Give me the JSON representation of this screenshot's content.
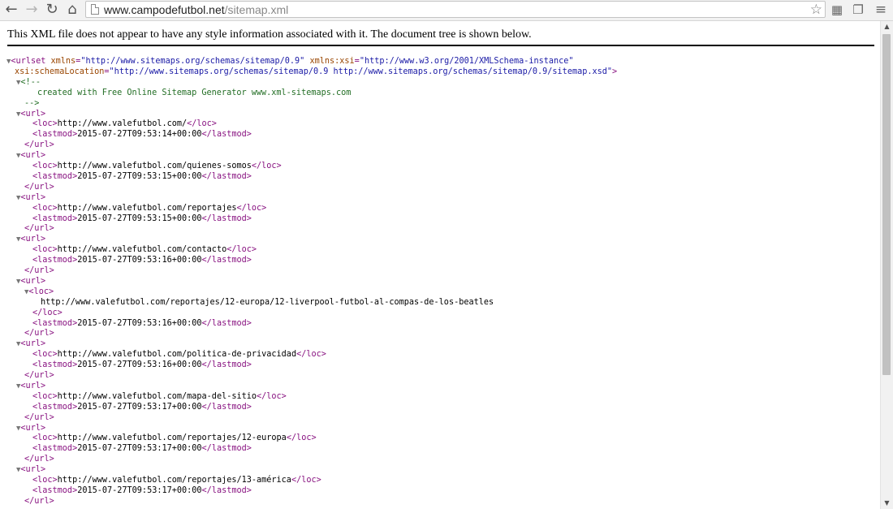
{
  "browser": {
    "url_domain": "www.campodefutbol.net",
    "url_path": "/sitemap.xml"
  },
  "icons": {
    "back": "arrow-left-icon",
    "forward": "arrow-right-icon",
    "reload": "reload-icon",
    "home": "home-icon",
    "page": "page-icon",
    "bookmark": "star-icon",
    "ext1": "extension-grid-icon",
    "ext2": "extension-pages-icon",
    "menu": "hamburger-menu-icon"
  },
  "notice": "This XML file does not appear to have any style information associated with it. The document tree is shown below.",
  "xml": {
    "root_open_1": "<urlset xmlns=\"http://www.sitemaps.org/schemas/sitemap/0.9\" xmlns:xsi=\"http://www.w3.org/2001/XMLSchema-instance\"",
    "root_open_2": "xsi:schemaLocation=\"http://www.sitemaps.org/schemas/sitemap/0.9 http://www.sitemaps.org/schemas/sitemap/0.9/sitemap.xsd\">",
    "comment_open": "<!--",
    "comment_text": "created with Free Online Sitemap Generator www.xml-sitemaps.com",
    "comment_close": "-->",
    "urls": [
      {
        "loc": "http://www.valefutbol.com/",
        "lastmod": "2015-07-27T09:53:14+00:00"
      },
      {
        "loc": "http://www.valefutbol.com/quienes-somos",
        "lastmod": "2015-07-27T09:53:15+00:00"
      },
      {
        "loc": "http://www.valefutbol.com/reportajes",
        "lastmod": "2015-07-27T09:53:15+00:00"
      },
      {
        "loc": "http://www.valefutbol.com/contacto",
        "lastmod": "2015-07-27T09:53:16+00:00"
      },
      {
        "loc": "http://www.valefutbol.com/reportajes/12-europa/12-liverpool-futbol-al-compas-de-los-beatles",
        "lastmod": "2015-07-27T09:53:16+00:00",
        "expanded": true
      },
      {
        "loc": "http://www.valefutbol.com/politica-de-privacidad",
        "lastmod": "2015-07-27T09:53:16+00:00"
      },
      {
        "loc": "http://www.valefutbol.com/mapa-del-sitio",
        "lastmod": "2015-07-27T09:53:17+00:00"
      },
      {
        "loc": "http://www.valefutbol.com/reportajes/12-europa",
        "lastmod": "2015-07-27T09:53:17+00:00"
      },
      {
        "loc": "http://www.valefutbol.com/reportajes/13-américa",
        "lastmod": "2015-07-27T09:53:17+00:00"
      }
    ]
  }
}
